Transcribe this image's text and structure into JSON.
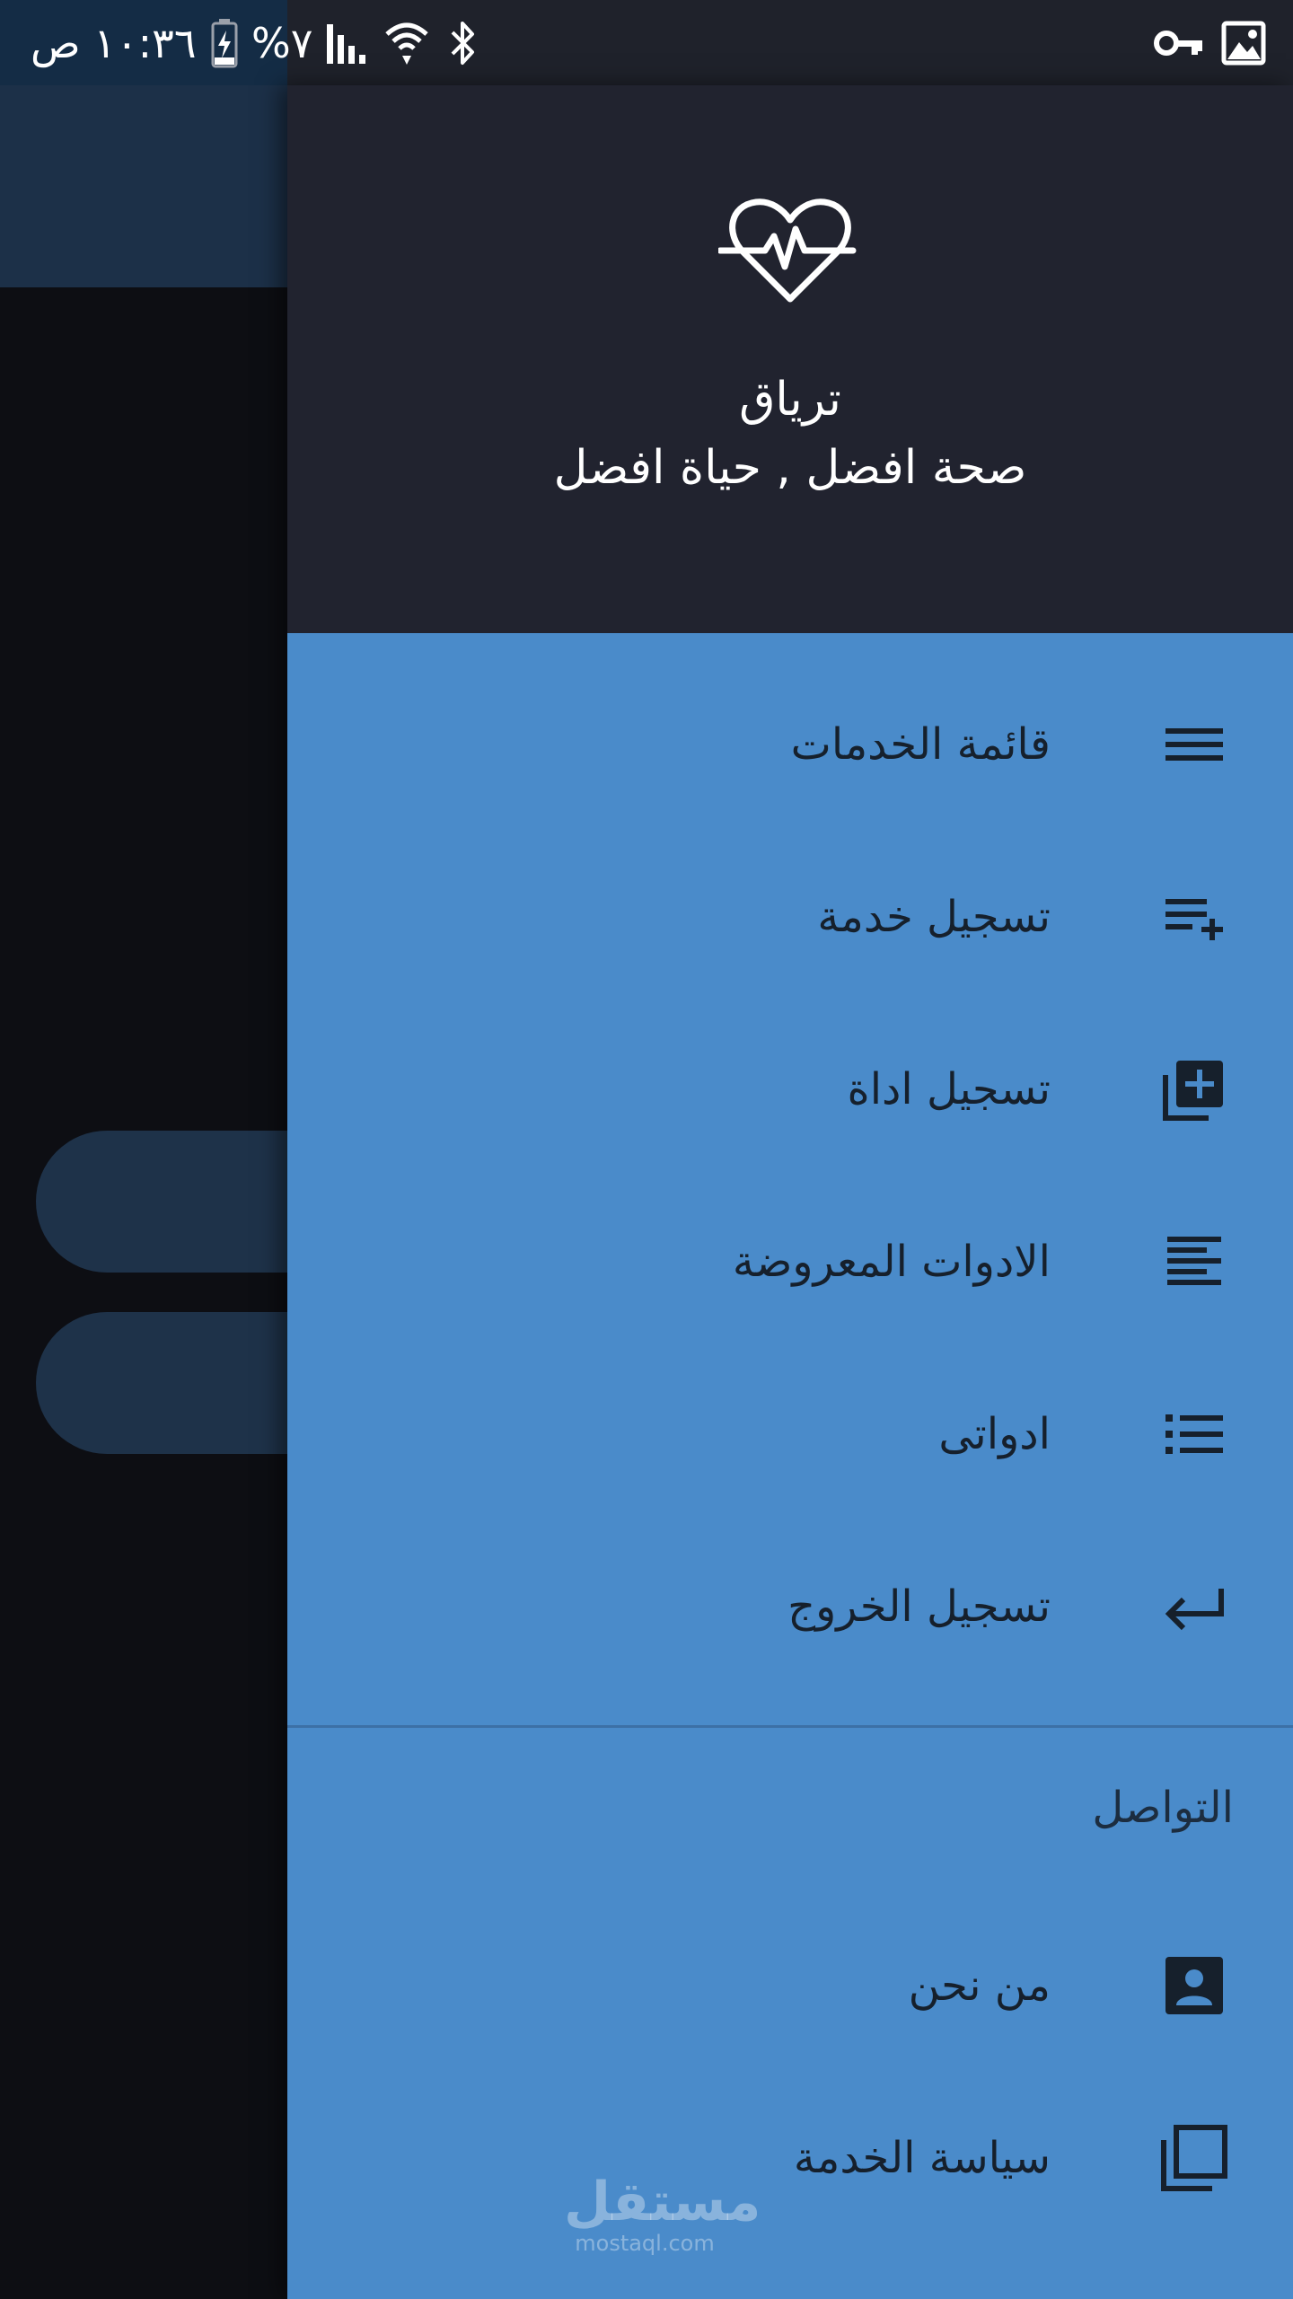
{
  "status_bar": {
    "time": "١٠:٣٦ ص",
    "battery": "%٧",
    "icons": [
      "battery-charging-icon",
      "signal-icon",
      "wifi-icon",
      "bluetooth-icon",
      "vpn-key-icon",
      "image-icon"
    ]
  },
  "drawer": {
    "header": {
      "logo_icon": "heart-pulse-icon",
      "title": "ترياق",
      "subtitle": "صحة افضل , حياة افضل"
    },
    "items": [
      {
        "label": "قائمة الخدمات",
        "icon": "menu-icon"
      },
      {
        "label": "تسجيل خدمة",
        "icon": "playlist-add-icon"
      },
      {
        "label": "تسجيل اداة",
        "icon": "library-add-icon"
      },
      {
        "label": "الادوات المعروضة",
        "icon": "align-text-icon"
      },
      {
        "label": "ادواتى",
        "icon": "list-icon"
      },
      {
        "label": "تسجيل الخروج",
        "icon": "return-arrow-icon"
      }
    ],
    "section_title": "التواصل",
    "contact_items": [
      {
        "label": "من نحن",
        "icon": "contact-card-icon"
      },
      {
        "label": "سياسة الخدمة",
        "icon": "copy-icon"
      }
    ]
  },
  "watermark": {
    "arabic": "مستقل",
    "latin": "mostaql.com"
  },
  "colors": {
    "drawer_bg": "#4a8bca",
    "header_bg": "#21232f",
    "text_dark": "#16202c"
  }
}
